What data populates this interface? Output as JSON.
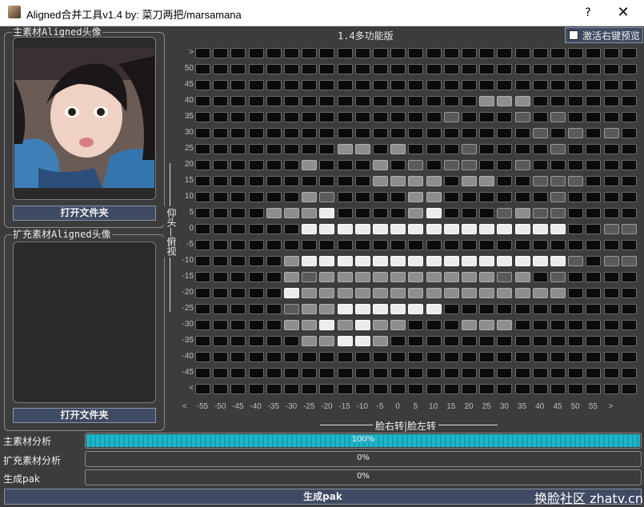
{
  "window": {
    "title": "Aligned合并工具v1.4  by: 菜刀两把/marsamana",
    "help_label": "?",
    "close_label": "✕"
  },
  "main_panel": {
    "title": "主素材Aligned头像",
    "open_button": "打开文件夹"
  },
  "ext_panel": {
    "title": "扩充素材Aligned头像",
    "open_button": "打开文件夹"
  },
  "version_label": "1.4多功能版",
  "right_click_preview": {
    "label": "激活右键预览",
    "checked": false
  },
  "y_labels": [
    ">",
    "50",
    "45",
    "40",
    "35",
    "30",
    "25",
    "20",
    "15",
    "10",
    "5",
    "0",
    "-5",
    "-10",
    "-15",
    "-20",
    "-25",
    "-30",
    "-35",
    "-40",
    "-45",
    "<"
  ],
  "x_labels": [
    "<",
    "-55",
    "-50",
    "-45",
    "-40",
    "-35",
    "-30",
    "-25",
    "-20",
    "-15",
    "-10",
    "-5",
    "0",
    "5",
    "10",
    "15",
    "20",
    "25",
    "30",
    "35",
    "40",
    "45",
    "50",
    "55",
    ">"
  ],
  "vertical_axis_label": "仰头—俯视",
  "horizontal_axis_label": "脸右转|脸左转",
  "grid_rows": [
    "0000000000000000000000000",
    "0000000000000000000000000",
    "0000000000000000000000000",
    "0000000000000000222000000",
    "0000000000000010001010000",
    "0000000000000000000101010",
    "0000000022020001000010000",
    "0000002000201011001000000",
    "0000000000222202200111000",
    "0000002100002200000010000",
    "0000222300002300012110000",
    "0000003333333333333330011",
    "0000000000000000000000000",
    "0000023333333333333331011",
    "0000021222222222212010000",
    "0000032222222222222220000",
    "0000012233333300000000000",
    "0000022323220002220000000",
    "0000002233200000000000000",
    "0000000000000000000000000",
    "0000000000000000000000000",
    "0000000000000000000000000"
  ],
  "progress": [
    {
      "label": "主素材分析",
      "value": 100,
      "text": "100%"
    },
    {
      "label": "扩充素材分析",
      "value": 0,
      "text": "0%"
    },
    {
      "label": "生成pak",
      "value": 0,
      "text": "0%"
    }
  ],
  "generate_button": "生成pak",
  "watermark": "换脸社区 zhatv.cn"
}
